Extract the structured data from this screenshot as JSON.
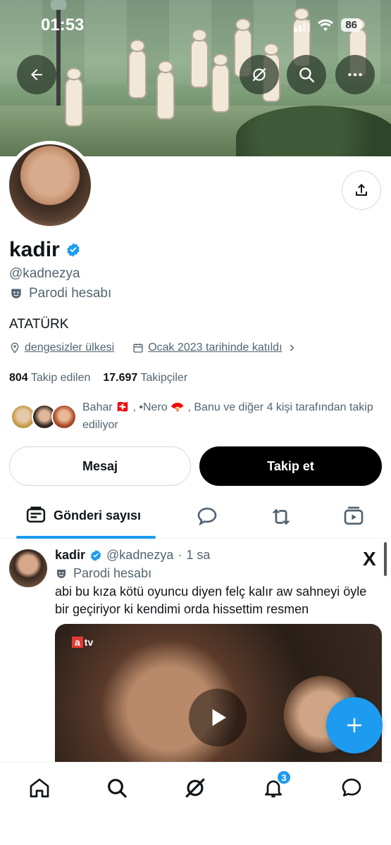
{
  "status_bar": {
    "time": "01:53",
    "battery": "86"
  },
  "profile": {
    "name": "kadir",
    "handle": "@kadnezya",
    "label": "Parodi hesabı",
    "bio": "ATATÜRK",
    "location": "dengesizler ülkesi",
    "joined": "Ocak 2023 tarihinde katıldı",
    "following_count": "804",
    "following_label": "Takip edilen",
    "followers_count": "17.697",
    "followers_label": "Takipçiler",
    "followed_by_line1": "Bahar 🇨🇭 , •Nero 🪭 , Banu ve diğer 4 kişi tarafından takip",
    "followed_by_line2": "ediliyor"
  },
  "actions": {
    "message": "Mesaj",
    "follow": "Takip et"
  },
  "tabs": [
    {
      "label": "Gönderi sayısı",
      "icon": "posts-icon",
      "active": true
    },
    {
      "label": "",
      "icon": "replies-icon"
    },
    {
      "label": "",
      "icon": "reposts-icon"
    },
    {
      "label": "",
      "icon": "media-icon"
    }
  ],
  "post": {
    "name": "kadir",
    "handle": "@kadnezya",
    "sep": "·",
    "time": "1 sa",
    "label": "Parodi hesabı",
    "text": "abi bu kıza kötü oyuncu diyen felç kalır aw sahneyi öyle bir geçiriyor ki kendimi orda hissettim resmen",
    "channel_logo": "tv",
    "channel_letter": "a",
    "source_logo": "X"
  },
  "bottom_nav": {
    "items": [
      "home-icon",
      "search-icon",
      "grok-icon",
      "notifications-icon",
      "messages-icon"
    ],
    "notifications_badge": "3"
  },
  "colors": {
    "accent": "#1d9bf0",
    "text": "#0f1419",
    "muted": "#536471"
  }
}
